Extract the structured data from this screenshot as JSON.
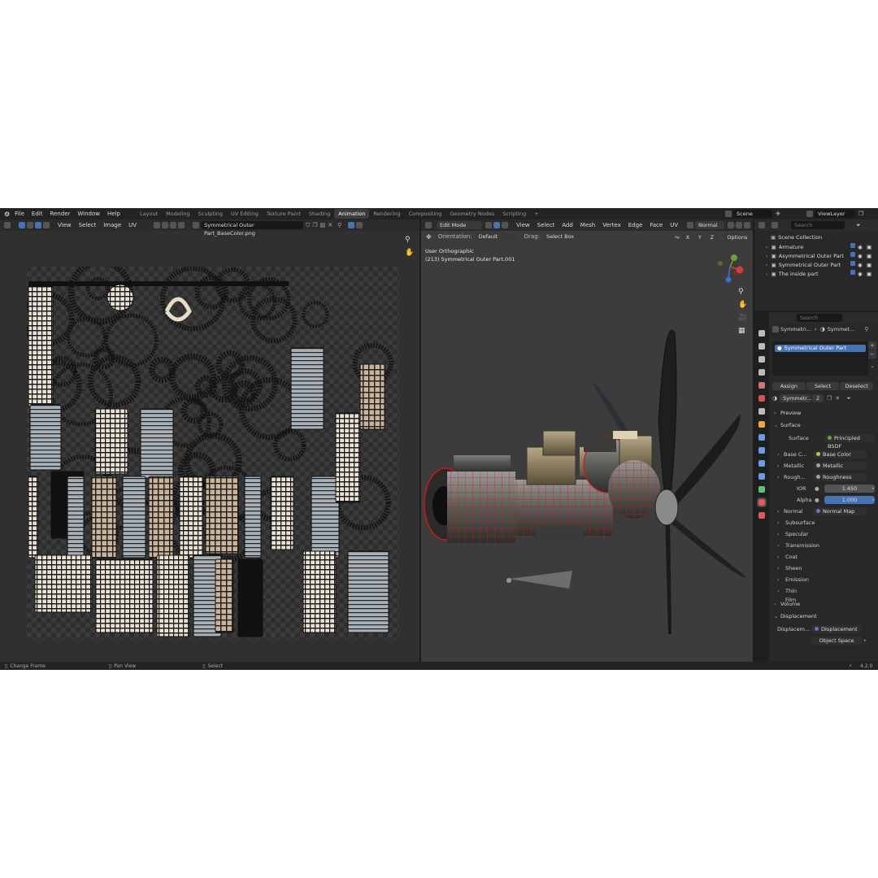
{
  "topbar": {
    "menus": [
      "File",
      "Edit",
      "Render",
      "Window",
      "Help"
    ],
    "workspaces": [
      "Layout",
      "Modeling",
      "Sculpting",
      "UV Editing",
      "Texture Paint",
      "Shading",
      "Animation",
      "Rendering",
      "Compositing",
      "Geometry Nodes",
      "Scripting"
    ],
    "active_workspace": "Animation",
    "add_tab": "+",
    "scene": "Scene",
    "view_layer": "ViewLayer"
  },
  "uv_editor": {
    "menus": [
      "View",
      "Select",
      "Image",
      "UV"
    ],
    "image_name": "Symmetrical Outer Part_BaseColor.png"
  },
  "viewport": {
    "mode": "Edit Mode",
    "menus": [
      "View",
      "Select",
      "Add",
      "Mesh",
      "Vertex",
      "Edge",
      "Face",
      "UV"
    ],
    "shading": "Normal",
    "orientation_label": "Orientation:",
    "orientation_value": "Default",
    "drag_label": "Drag:",
    "drag_value": "Select Box",
    "axes": [
      "X",
      "Y",
      "Z"
    ],
    "options": "Options",
    "view_title": "User Orthographic",
    "object_info": "(213) Symmetrical Outer Part.001"
  },
  "outliner": {
    "search_placeholder": "Search",
    "collection": "Scene Collection",
    "items": [
      "Armature",
      "Asymmetrical Outer Part",
      "Symmetrical Outer Part",
      "The inside part"
    ]
  },
  "properties": {
    "search_placeholder": "Search",
    "breadcrumb_object": "Symmetri...",
    "breadcrumb_material": "Symmet...",
    "material_slot": "Symmetrical Outer Part",
    "assign": "Assign",
    "select": "Select",
    "deselect": "Deselect",
    "material_field": "Symmetr...",
    "user_count": "2",
    "panels": {
      "preview": "Preview",
      "surface_panel": "Surface",
      "surface_label": "Surface",
      "surface_value": "Principled BSDF",
      "base_color_label": "Base C...",
      "base_color_value": "Base Color",
      "metallic_label": "Metallic",
      "metallic_value": "Metallic",
      "roughness_label": "Rough...",
      "roughness_value": "Roughness",
      "ior_label": "IOR",
      "ior_value": "1.450",
      "alpha_label": "Alpha",
      "alpha_value": "1.000",
      "normal_label": "Normal",
      "normal_value": "Normal Map",
      "subpanels": [
        "Subsurface",
        "Specular",
        "Transmission",
        "Coat",
        "Sheen",
        "Emission",
        "Thin Film"
      ],
      "volume": "Volume",
      "displacement": "Displacement",
      "displacement_label": "Displacem...",
      "displacement_value": "Displacement",
      "space_value": "Object Space"
    }
  },
  "statusbar": {
    "left": "Change Frame",
    "middle": "Pan View",
    "right": "Select",
    "version": "4.2.0"
  },
  "colors": {
    "accent": "#4772b3",
    "active_tab": "#3d3d3d",
    "wire_selected": "#d01818",
    "axis_x": "#d03c3c",
    "axis_y": "#6aa23a",
    "axis_z": "#3c70d0"
  }
}
